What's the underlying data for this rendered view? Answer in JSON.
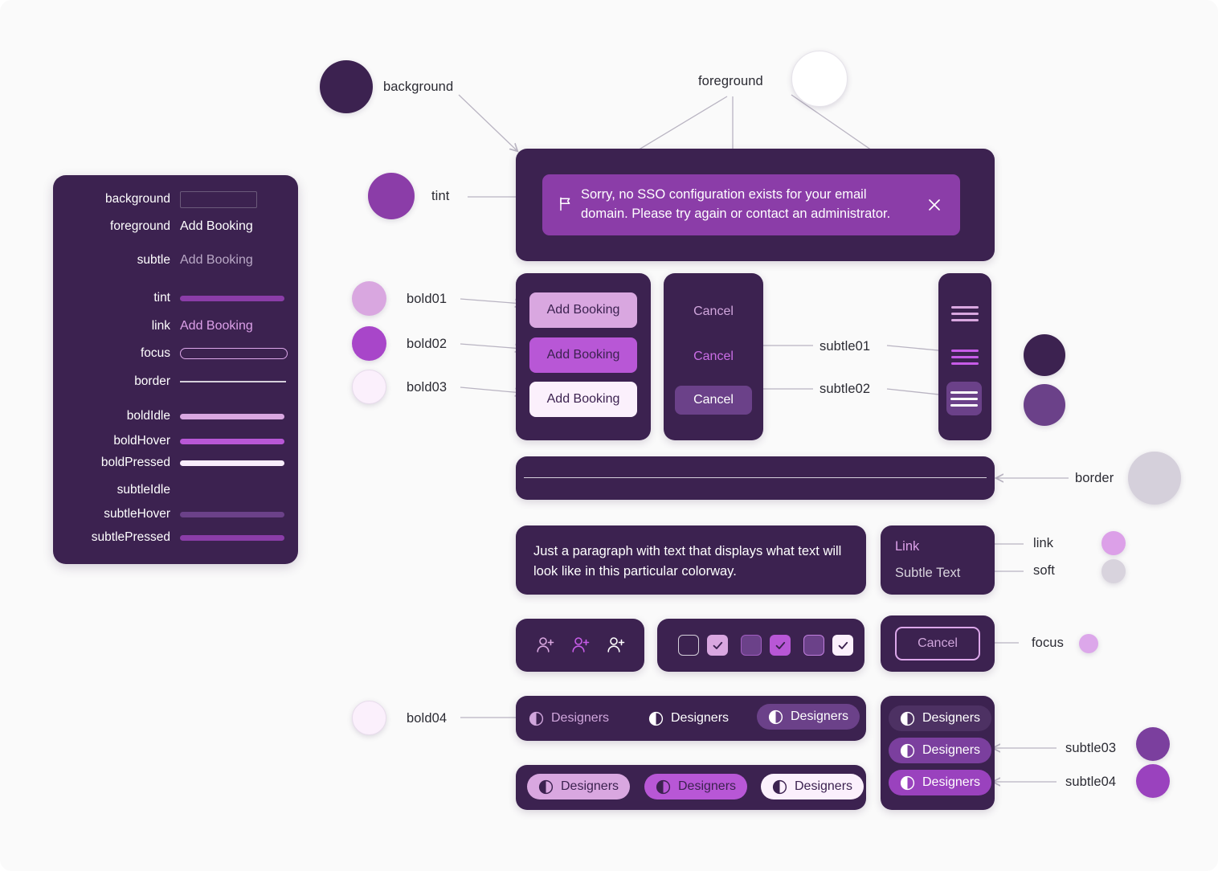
{
  "palette": {
    "background": "#3c2250",
    "foreground": "#ffffff",
    "subtle": "#b9a8c6",
    "tint": "#8b3da8",
    "link": "#dca0e8",
    "focus": "#dca7ea",
    "border": "#d5d0db",
    "soft": "#d8d3dd",
    "boldIdle": "#d9a7e0",
    "boldHover": "#b857d6",
    "boldPressed": "#f8ecfb",
    "subtleIdle": "transparent",
    "subtleHover": "#6b4189",
    "subtlePressed": "#8b3da8",
    "bold01": "#d9a7e0",
    "bold02": "#a846c9",
    "bold03": "#fbf0fc",
    "bold04": "#fbf0fc",
    "subtle01": "#3c2250",
    "subtle02": "#6b4189",
    "subtle03": "#7b3f9e",
    "subtle04": "#9a42be",
    "canvas": "#fafafa",
    "wire": "#b9b4c2",
    "label_text": "#2b2b33"
  },
  "legend": {
    "rows": [
      {
        "name": "background",
        "kind": "box"
      },
      {
        "name": "foreground",
        "kind": "text",
        "text": "Add Booking",
        "color_key": "foreground"
      },
      {
        "name": "subtle",
        "kind": "text",
        "text": "Add Booking",
        "color_key": "subtle"
      },
      {
        "name": "tint",
        "kind": "bar",
        "color_key": "tint"
      },
      {
        "name": "link",
        "kind": "text",
        "text": "Add Booking",
        "color_key": "link"
      },
      {
        "name": "focus",
        "kind": "pill",
        "color_key": "focus"
      },
      {
        "name": "border",
        "kind": "line",
        "color_key": "border"
      },
      {
        "name": "boldIdle",
        "kind": "bar",
        "color_key": "boldIdle"
      },
      {
        "name": "boldHover",
        "kind": "bar",
        "color_key": "boldHover"
      },
      {
        "name": "boldPressed",
        "kind": "bar",
        "color_key": "boldPressed"
      },
      {
        "name": "subtleIdle",
        "kind": "bar",
        "color_key": "subtleIdle"
      },
      {
        "name": "subtleHover",
        "kind": "bar",
        "color_key": "subtleHover"
      },
      {
        "name": "subtlePressed",
        "kind": "bar",
        "color_key": "subtlePressed"
      }
    ]
  },
  "annotations": {
    "background": "background",
    "foreground": "foreground",
    "tint": "tint",
    "bold01": "bold01",
    "bold02": "bold02",
    "bold03": "bold03",
    "bold04": "bold04",
    "subtle01": "subtle01",
    "subtle02": "subtle02",
    "subtle03": "subtle03",
    "subtle04": "subtle04",
    "border": "border",
    "link": "link",
    "soft": "soft",
    "focus": "focus"
  },
  "alert": {
    "message": "Sorry, no SSO configuration exists for your email domain. Please try again or contact an administrator.",
    "flag_icon": "flag-icon",
    "close_icon": "close-icon"
  },
  "buttons": {
    "add_booking": "Add Booking",
    "cancel": "Cancel"
  },
  "menu": {
    "icon": "hamburger-icon"
  },
  "paragraph": {
    "text": "Just a paragraph with text that displays what text will look like in this particular colorway."
  },
  "links_card": {
    "link_label": "Link",
    "subtle_label": "Subtle Text"
  },
  "people_icons": {
    "icon": "add-person-icon"
  },
  "chips": {
    "label": "Designers",
    "icon": "half-circle-icon"
  }
}
